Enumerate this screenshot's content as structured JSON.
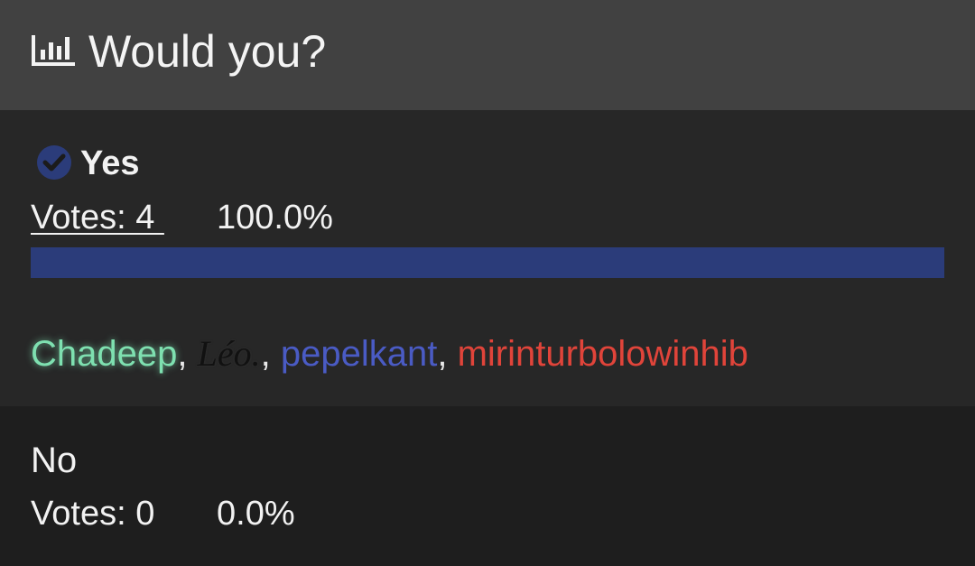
{
  "header": {
    "icon": "poll-chart-icon",
    "title": "Would you?"
  },
  "options": [
    {
      "label": "Yes",
      "selected": true,
      "votes_text": "Votes: 4 ",
      "percent_text": "100.0%",
      "fraction": 1.0,
      "voters": [
        {
          "name": "Chadeep",
          "color": "#7ee0b0"
        },
        {
          "name": "Léo.",
          "color": "#111111"
        },
        {
          "name": "pepelkant",
          "color": "#4a5bc4"
        },
        {
          "name": "mirinturbolowinhib",
          "color": "#e0443a"
        }
      ]
    },
    {
      "label": "No",
      "selected": false,
      "votes_text": "Votes: 0",
      "percent_text": "0.0%",
      "fraction": 0.0,
      "voters": []
    }
  ],
  "colors": {
    "accent": "#2b3c7a",
    "header_bg": "#414141",
    "option_bg": "#272727"
  }
}
